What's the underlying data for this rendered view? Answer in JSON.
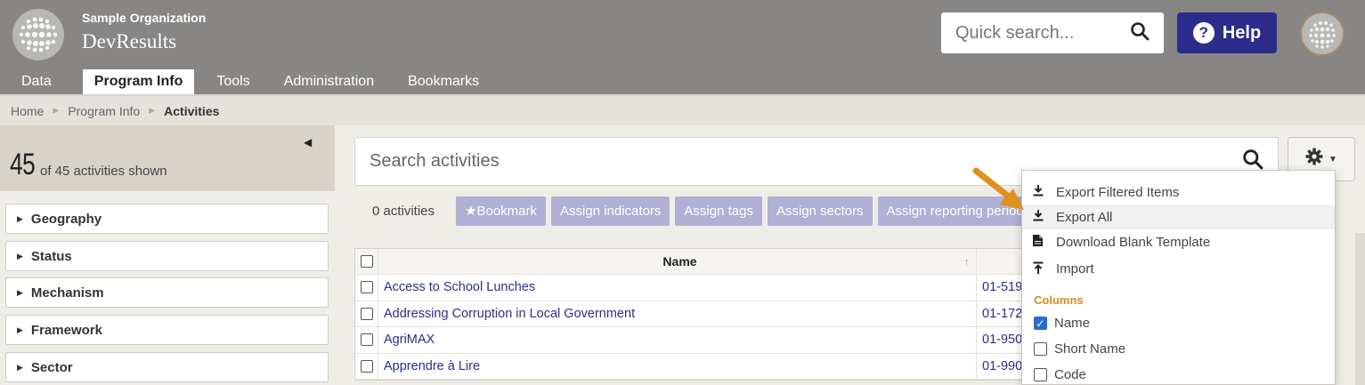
{
  "header": {
    "org_name": "Sample Organization",
    "app_name": "DevResults",
    "quick_search_placeholder": "Quick search...",
    "help_label": "Help"
  },
  "nav": {
    "tabs": [
      {
        "label": "Data",
        "active": false
      },
      {
        "label": "Program Info",
        "active": true
      },
      {
        "label": "Tools",
        "active": false
      },
      {
        "label": "Administration",
        "active": false
      },
      {
        "label": "Bookmarks",
        "active": false
      }
    ]
  },
  "breadcrumb": [
    "Home",
    "Program Info",
    "Activities"
  ],
  "sidebar": {
    "count": "45",
    "count_text": "of 45 activities shown",
    "filters": [
      "Geography",
      "Status",
      "Mechanism",
      "Framework",
      "Sector"
    ]
  },
  "main": {
    "search_placeholder": "Search activities",
    "activity_count": "0 activities",
    "toolbar_buttons": [
      "★Bookmark",
      "Assign indicators",
      "Assign tags",
      "Assign sectors",
      "Assign reporting periods"
    ],
    "table": {
      "name_header": "Name",
      "rows": [
        {
          "name": "Access to School Lunches",
          "code": "01-519"
        },
        {
          "name": "Addressing Corruption in Local Government",
          "code": "01-172"
        },
        {
          "name": "AgriMAX",
          "code": "01-950"
        },
        {
          "name": "Apprendre à Lire",
          "code": "01-990"
        }
      ]
    }
  },
  "dropdown": {
    "items": [
      "Export Filtered Items",
      "Export All",
      "Download Blank Template",
      "Import"
    ],
    "columns_header": "Columns",
    "columns": [
      {
        "label": "Name",
        "checked": true
      },
      {
        "label": "Short Name",
        "checked": false
      },
      {
        "label": "Code",
        "checked": false
      }
    ]
  },
  "colors": {
    "header_bg": "#888684",
    "help_bg": "#2c2c8c",
    "toolbar_btn": "#b1afd4",
    "link": "#2d2d8c",
    "accent_orange": "#d48a21",
    "checkbox_checked": "#2a6ad4"
  }
}
